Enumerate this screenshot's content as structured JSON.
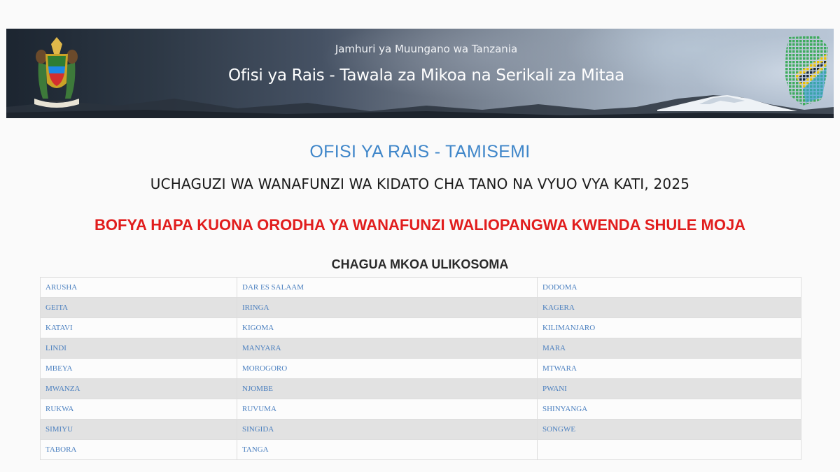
{
  "banner": {
    "subtitle": "Jamhuri ya Muungano wa Tanzania",
    "title": "Ofisi ya Rais - Tawala za Mikoa na Serikali za Mitaa"
  },
  "heading": {
    "office": "OFISI YA RAIS - TAMISEMI",
    "selection": "UCHAGUZI WA WANAFUNZI WA KIDATO CHA TANO NA VYUO VYA KATI, 2025",
    "bofya_link": "BOFYA HAPA KUONA ORODHA YA WANAFUNZI WALIOPANGWA KWENDA SHULE MOJA",
    "chagua": "CHAGUA MKOA ULIKOSOMA"
  },
  "regions": [
    [
      "ARUSHA",
      "DAR ES SALAAM",
      "DODOMA"
    ],
    [
      "GEITA",
      "IRINGA",
      "KAGERA"
    ],
    [
      "KATAVI",
      "KIGOMA",
      "KILIMANJARO"
    ],
    [
      "LINDI",
      "MANYARA",
      "MARA"
    ],
    [
      "MBEYA",
      "MOROGORO",
      "MTWARA"
    ],
    [
      "MWANZA",
      "NJOMBE",
      "PWANI"
    ],
    [
      "RUKWA",
      "RUVUMA",
      "SHINYANGA"
    ],
    [
      "SIMIYU",
      "SINGIDA",
      "SONGWE"
    ],
    [
      "TABORA",
      "TANGA",
      ""
    ]
  ],
  "colors": {
    "office_blue": "#3f86c9",
    "link_red": "#e11d1d",
    "region_link": "#4a7fbf",
    "row_stripe": "#e2e2e2"
  },
  "icons": {
    "coat_of_arms": "tanzania-coat-of-arms-icon",
    "map": "tanzania-map-icon"
  }
}
